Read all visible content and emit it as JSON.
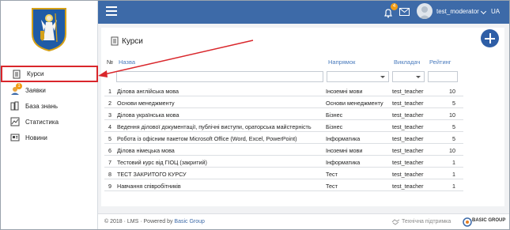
{
  "sidebar": {
    "items": [
      {
        "label": "Курси",
        "icon": "courses-icon",
        "active": true
      },
      {
        "label": "Заявки",
        "icon": "requests-icon",
        "badge": "1"
      },
      {
        "label": "База знань",
        "icon": "knowledge-base-icon"
      },
      {
        "label": "Статистика",
        "icon": "statistics-icon"
      },
      {
        "label": "Новини",
        "icon": "news-icon"
      }
    ]
  },
  "header": {
    "notifications_count": "4",
    "username": "test_moderator",
    "language": "UA"
  },
  "main": {
    "title": "Курси",
    "columns": {
      "num": "№",
      "name": "Назва",
      "direction": "Напрямок",
      "teacher": "Викладач",
      "rating": "Рейтинг"
    },
    "rows": [
      {
        "num": "1",
        "name": "Ділова англійська мова",
        "direction": "Іноземні мови",
        "teacher": "test_teacher",
        "rating": "10"
      },
      {
        "num": "2",
        "name": "Основи менеджменту",
        "direction": "Основи менеджменту",
        "teacher": "test_teacher",
        "rating": "5"
      },
      {
        "num": "3",
        "name": "Ділова українська мова",
        "direction": "Бізнес",
        "teacher": "test_teacher",
        "rating": "10"
      },
      {
        "num": "4",
        "name": "Ведення ділової документації, публічні виступи, ораторська майстерність",
        "direction": "Бізнес",
        "teacher": "test_teacher",
        "rating": "5"
      },
      {
        "num": "5",
        "name": "Робота із офісним пакетом Microsoft Office (Word, Excel, PowerPoint)",
        "direction": "Інформатика",
        "teacher": "test_teacher",
        "rating": "5"
      },
      {
        "num": "6",
        "name": "Ділова німецька мова",
        "direction": "Іноземні мови",
        "teacher": "test_teacher",
        "rating": "10"
      },
      {
        "num": "7",
        "name": "Тестовий курс від ГІОЦ (закритий)",
        "direction": "Інформатика",
        "teacher": "test_teacher",
        "rating": "1"
      },
      {
        "num": "8",
        "name": "ТЕСТ ЗАКРИТОГО КУРСУ",
        "direction": "Тест",
        "teacher": "test_teacher",
        "rating": "1"
      },
      {
        "num": "9",
        "name": "Навчання співробітників",
        "direction": "Тест",
        "teacher": "test_teacher",
        "rating": "1"
      }
    ]
  },
  "footer": {
    "copyright": "© 2018 · LMS · Powered by ",
    "company_link": "Basic Group",
    "support": "Технічна підтримка",
    "brand": "BASIC GROUP"
  },
  "colors": {
    "topbar": "#3d6aa8",
    "accent": "#2e5ea6",
    "highlight": "#d9262b",
    "badge": "#f39c12"
  }
}
